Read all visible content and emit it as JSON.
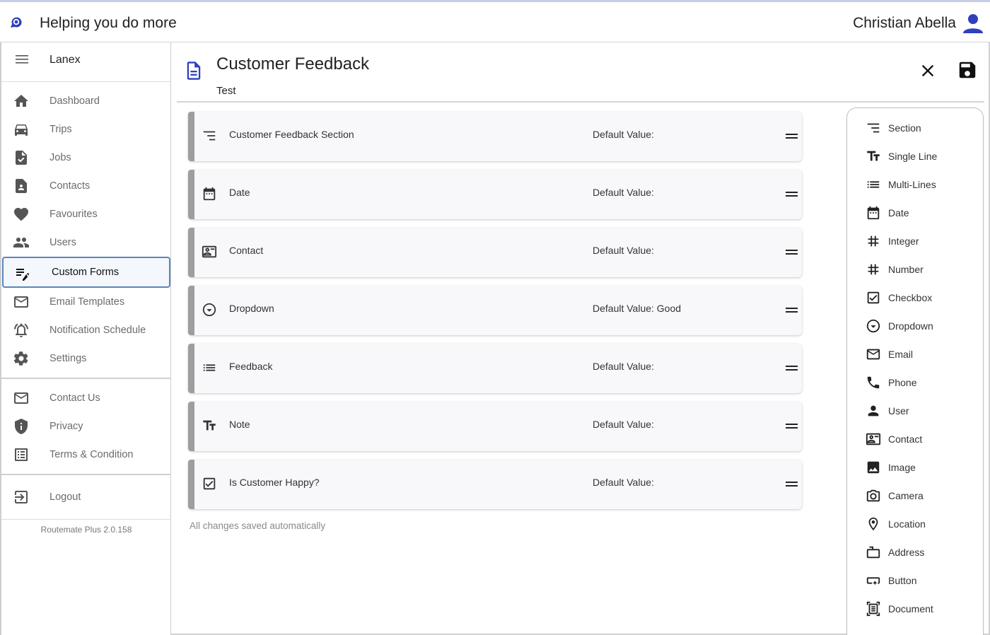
{
  "topbar": {
    "title": "Helping you do more",
    "user_name": "Christian Abella"
  },
  "sidebar": {
    "org": "Lanex",
    "items": [
      {
        "label": "Dashboard",
        "icon": "home-icon"
      },
      {
        "label": "Trips",
        "icon": "car-icon"
      },
      {
        "label": "Jobs",
        "icon": "file-check-icon"
      },
      {
        "label": "Contacts",
        "icon": "contact-file-icon"
      },
      {
        "label": "Favourites",
        "icon": "heart-icon"
      },
      {
        "label": "Users",
        "icon": "people-icon"
      },
      {
        "label": "Custom Forms",
        "icon": "edit-list-icon",
        "active": true
      },
      {
        "label": "Email Templates",
        "icon": "mail-icon"
      },
      {
        "label": "Notification Schedule",
        "icon": "alarm-icon"
      },
      {
        "label": "Settings",
        "icon": "gear-icon"
      }
    ],
    "secondary": [
      {
        "label": "Contact Us",
        "icon": "mail-icon"
      },
      {
        "label": "Privacy",
        "icon": "shield-icon"
      },
      {
        "label": "Terms & Condition",
        "icon": "list-box-icon"
      }
    ],
    "logout": "Logout",
    "version": "Routemate Plus 2.0.158"
  },
  "form": {
    "title": "Customer Feedback",
    "subtitle": "Test",
    "fields": [
      {
        "label": "Customer Feedback Section",
        "default": "Default Value:",
        "icon": "section-icon"
      },
      {
        "label": "Date",
        "default": "Default Value:",
        "icon": "calendar-icon"
      },
      {
        "label": "Contact",
        "default": "Default Value:",
        "icon": "contact-card-icon"
      },
      {
        "label": "Dropdown",
        "default": "Default Value: Good",
        "icon": "dropdown-circle-icon"
      },
      {
        "label": "Feedback",
        "default": "Default Value:",
        "icon": "list-icon"
      },
      {
        "label": "Note",
        "default": "Default Value:",
        "icon": "text-size-icon"
      },
      {
        "label": "Is Customer Happy?",
        "default": "Default Value:",
        "icon": "checkbox-icon"
      }
    ],
    "autosave": "All changes saved automatically"
  },
  "palette": [
    {
      "label": "Section",
      "icon": "section-icon"
    },
    {
      "label": "Single Line",
      "icon": "text-size-icon"
    },
    {
      "label": "Multi-Lines",
      "icon": "list-icon"
    },
    {
      "label": "Date",
      "icon": "calendar-icon"
    },
    {
      "label": "Integer",
      "icon": "hash-icon"
    },
    {
      "label": "Number",
      "icon": "hash-icon"
    },
    {
      "label": "Checkbox",
      "icon": "checkbox-icon"
    },
    {
      "label": "Dropdown",
      "icon": "dropdown-circle-icon"
    },
    {
      "label": "Email",
      "icon": "mail-icon"
    },
    {
      "label": "Phone",
      "icon": "phone-icon"
    },
    {
      "label": "User",
      "icon": "person-icon"
    },
    {
      "label": "Contact",
      "icon": "contact-card-icon"
    },
    {
      "label": "Image",
      "icon": "image-icon"
    },
    {
      "label": "Camera",
      "icon": "camera-icon"
    },
    {
      "label": "Location",
      "icon": "location-pin-icon"
    },
    {
      "label": "Address",
      "icon": "address-icon"
    },
    {
      "label": "Button",
      "icon": "button-icon"
    },
    {
      "label": "Document",
      "icon": "document-scan-icon"
    }
  ],
  "colors": {
    "accent": "#2f3fbf",
    "active_border": "#5a86b8",
    "handle": "#9e9e9e"
  }
}
